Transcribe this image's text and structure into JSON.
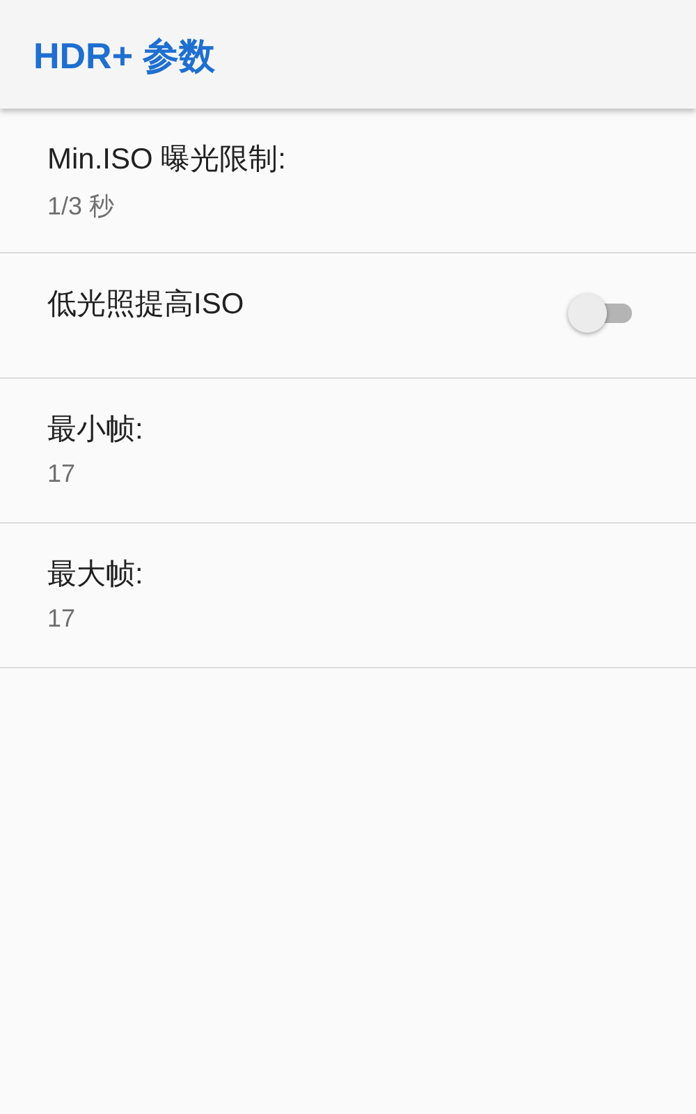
{
  "app_bar": {
    "title": "HDR+ 参数"
  },
  "settings": [
    {
      "kind": "value",
      "title": "Min.ISO 曝光限制:",
      "summary": "1/3 秒"
    },
    {
      "kind": "switch",
      "title": "低光照提高ISO",
      "on": false
    },
    {
      "kind": "value",
      "title": "最小帧:",
      "summary": "17"
    },
    {
      "kind": "value",
      "title": "最大帧:",
      "summary": "17"
    }
  ]
}
